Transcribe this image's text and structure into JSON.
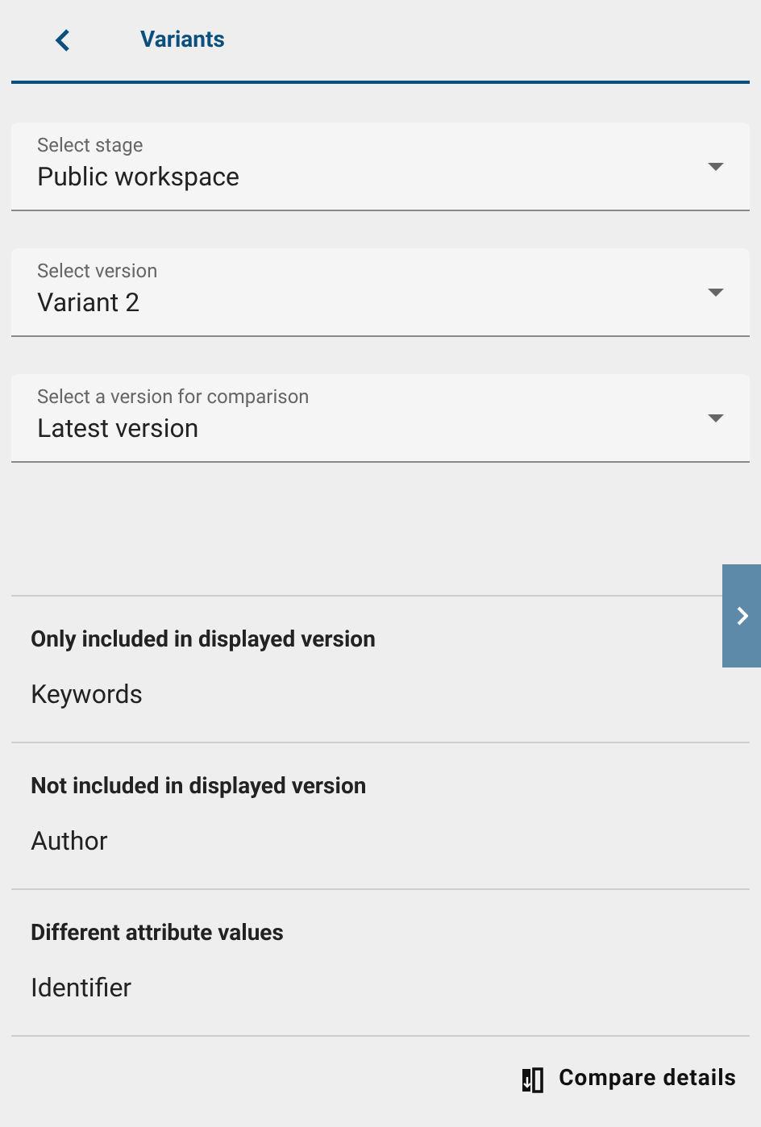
{
  "header": {
    "title": "Variants"
  },
  "selects": [
    {
      "label": "Select stage",
      "value": "Public workspace"
    },
    {
      "label": "Select version",
      "value": "Variant 2"
    },
    {
      "label": "Select a version for comparison",
      "value": "Latest version"
    }
  ],
  "sections": [
    {
      "title": "Only included in displayed version",
      "items": [
        "Keywords"
      ]
    },
    {
      "title": "Not included in displayed version",
      "items": [
        "Author"
      ]
    },
    {
      "title": "Different attribute values",
      "items": [
        "Identifier"
      ]
    }
  ],
  "compare_button": {
    "label": "Compare details"
  }
}
